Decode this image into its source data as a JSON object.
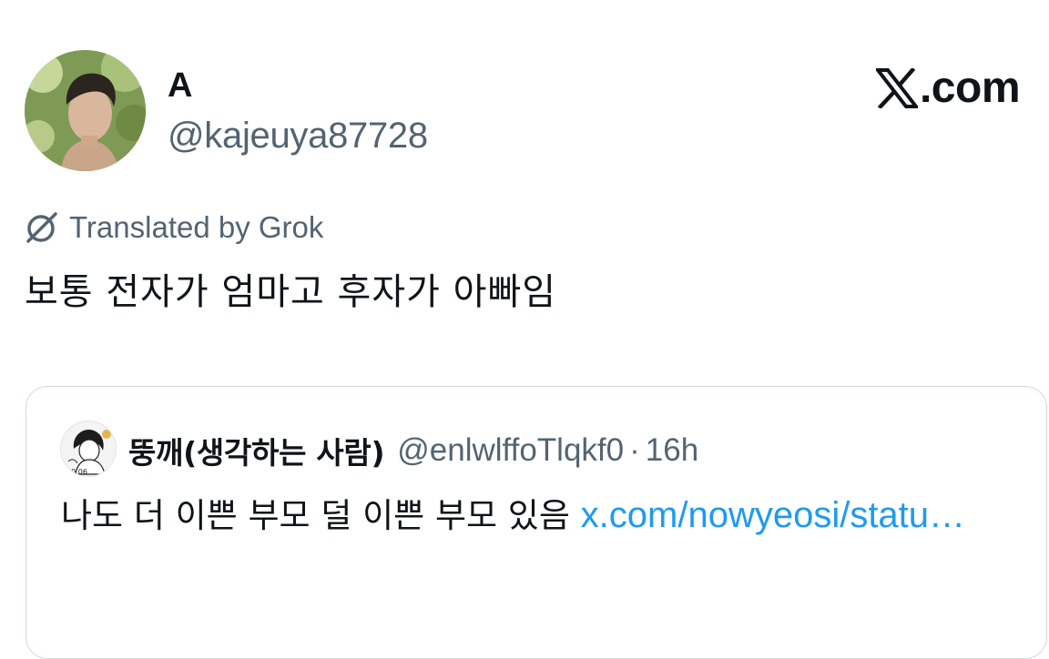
{
  "author": {
    "display_name": "A",
    "handle": "@kajeuya87728",
    "avatar_icon": "profile-photo"
  },
  "brand": {
    "icon": "x-logo-icon",
    "text": ".com"
  },
  "translation": {
    "icon": "grok-icon",
    "label": "Translated by Grok"
  },
  "tweet": {
    "text": "보통 전자가 엄마고 후자가 아빠임"
  },
  "quoted_tweet": {
    "display_name": "뚱깨(생각하는 사람)",
    "handle": "@enlwlffoTlqkf0",
    "separator": "·",
    "time": "16h",
    "text": "나도 더 이쁜 부모 덜 이쁜 부모 있음 ",
    "link": "x.com/nowyeosi/statu…",
    "avatar_icon": "profile-drawing"
  },
  "colors": {
    "text_primary": "#0f1419",
    "text_secondary": "#536471",
    "link": "#1d9bf0",
    "border": "#cfd9de"
  }
}
